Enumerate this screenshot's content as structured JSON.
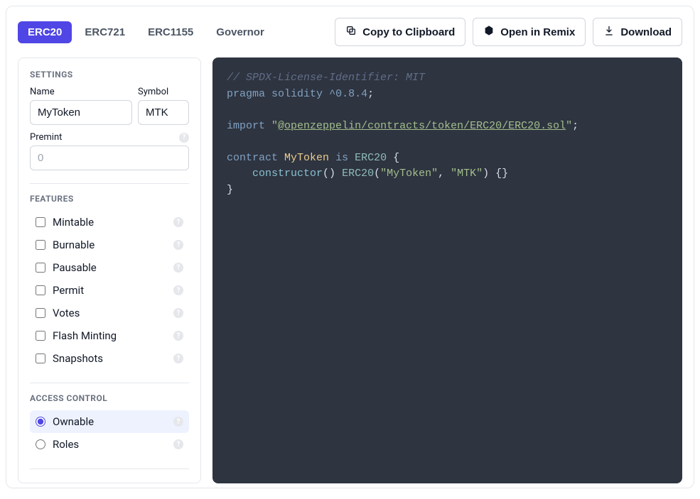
{
  "tabs": [
    {
      "label": "ERC20",
      "active": true
    },
    {
      "label": "ERC721",
      "active": false
    },
    {
      "label": "ERC1155",
      "active": false
    },
    {
      "label": "Governor",
      "active": false
    }
  ],
  "actions": {
    "copy": "Copy to Clipboard",
    "remix": "Open in Remix",
    "download": "Download"
  },
  "settings": {
    "heading": "SETTINGS",
    "name_label": "Name",
    "name_value": "MyToken",
    "symbol_label": "Symbol",
    "symbol_value": "MTK",
    "premint_label": "Premint",
    "premint_placeholder": "0",
    "premint_value": ""
  },
  "features": {
    "heading": "FEATURES",
    "items": [
      {
        "label": "Mintable",
        "checked": false
      },
      {
        "label": "Burnable",
        "checked": false
      },
      {
        "label": "Pausable",
        "checked": false
      },
      {
        "label": "Permit",
        "checked": false
      },
      {
        "label": "Votes",
        "checked": false
      },
      {
        "label": "Flash Minting",
        "checked": false
      },
      {
        "label": "Snapshots",
        "checked": false
      }
    ]
  },
  "access": {
    "heading": "ACCESS CONTROL",
    "items": [
      {
        "label": "Ownable",
        "selected": true
      },
      {
        "label": "Roles",
        "selected": false
      }
    ]
  },
  "code": {
    "comment": "// SPDX-License-Identifier: MIT",
    "pragma_kw": "pragma",
    "solidity_kw": "solidity",
    "version": "^0.8.4",
    "import_kw": "import",
    "import_path": "@openzeppelin/contracts/token/ERC20/ERC20.sol",
    "contract_kw": "contract",
    "contract_name": "MyToken",
    "is_kw": "is",
    "base": "ERC20",
    "constructor_kw": "constructor",
    "arg1": "\"MyToken\"",
    "arg2": "\"MTK\""
  }
}
